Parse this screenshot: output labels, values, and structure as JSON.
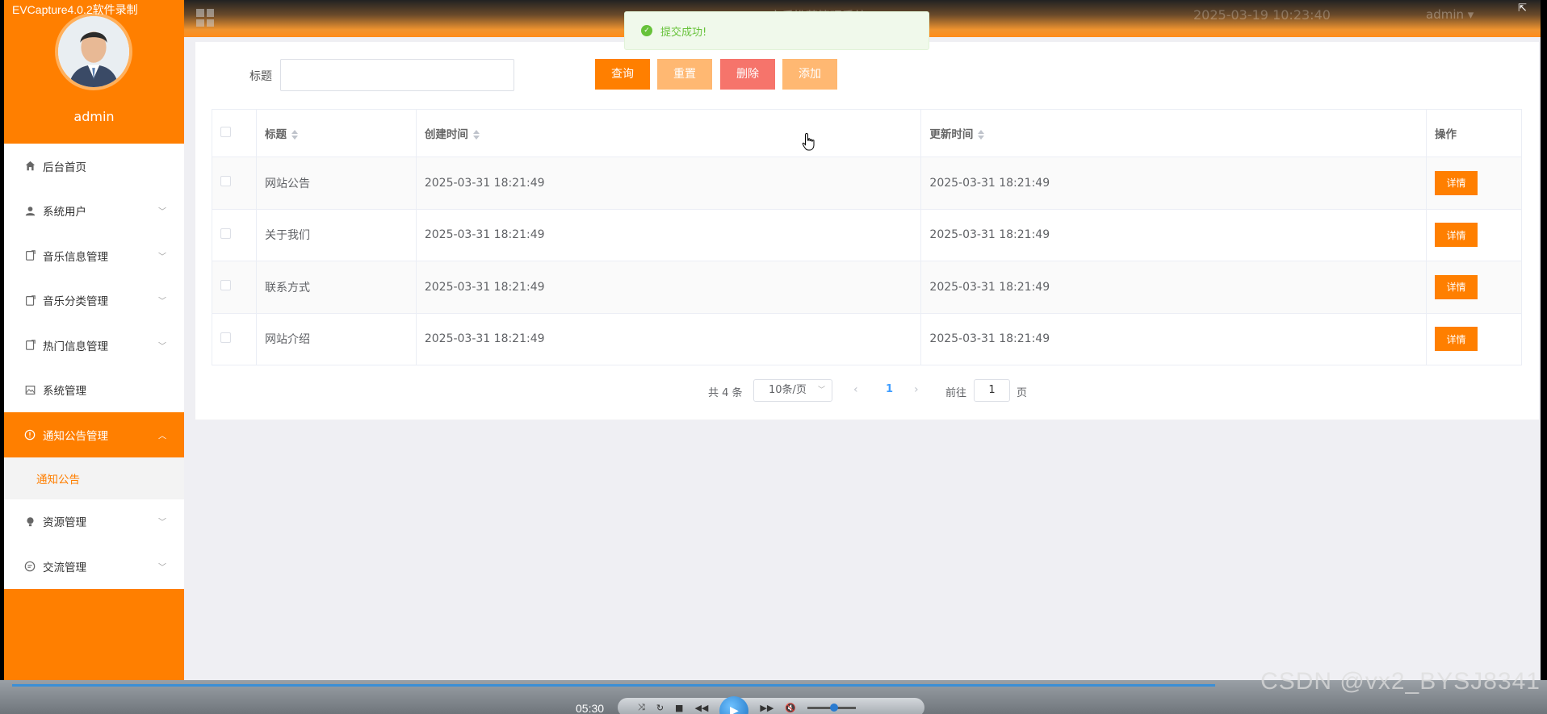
{
  "window": {
    "caption": "EVCapture4.0.2软件录制"
  },
  "topbar": {
    "system_title": "音乐推荐管理系统",
    "datetime": "2025-03-19 10:23:40",
    "user": "admin ▾"
  },
  "sidebar": {
    "admin_name": "admin",
    "items": [
      {
        "label": "后台首页",
        "icon": "home-icon"
      },
      {
        "label": "系统用户",
        "icon": "user-icon"
      },
      {
        "label": "音乐信息管理",
        "icon": "document-icon"
      },
      {
        "label": "音乐分类管理",
        "icon": "document-icon"
      },
      {
        "label": "热门信息管理",
        "icon": "document-icon"
      },
      {
        "label": "系统管理",
        "icon": "image-icon"
      },
      {
        "label": "通知公告管理",
        "icon": "alert-circle-icon"
      },
      {
        "label": "资源管理",
        "icon": "bulb-icon"
      },
      {
        "label": "交流管理",
        "icon": "chat-icon"
      }
    ],
    "submenu": {
      "label": "通知公告"
    }
  },
  "search": {
    "title_label": "标题",
    "title_value": "",
    "buttons": {
      "query": "查询",
      "reset": "重置",
      "delete": "删除",
      "add": "添加"
    }
  },
  "table": {
    "headers": {
      "title": "标题",
      "created": "创建时间",
      "updated": "更新时间",
      "action": "操作"
    },
    "rows": [
      {
        "title": "网站公告",
        "created": "2025-03-31 18:21:49",
        "updated": "2025-03-31 18:21:49",
        "action": "详情"
      },
      {
        "title": "关于我们",
        "created": "2025-03-31 18:21:49",
        "updated": "2025-03-31 18:21:49",
        "action": "详情"
      },
      {
        "title": "联系方式",
        "created": "2025-03-31 18:21:49",
        "updated": "2025-03-31 18:21:49",
        "action": "详情"
      },
      {
        "title": "网站介绍",
        "created": "2025-03-31 18:21:49",
        "updated": "2025-03-31 18:21:49",
        "action": "详情"
      }
    ]
  },
  "pagination": {
    "total": "共 4 条",
    "page_size": "10条/页",
    "current_page": "1",
    "goto_prefix": "前往",
    "goto_value": "1",
    "goto_suffix": "页"
  },
  "toast": {
    "message": "提交成功!"
  },
  "player": {
    "time": "05:30"
  },
  "watermark": "CSDN @vx2_BYSJ8341",
  "colors": {
    "accent": "#ff7f00",
    "danger": "#f6746b",
    "success": "#67c23a",
    "link": "#409eff"
  }
}
